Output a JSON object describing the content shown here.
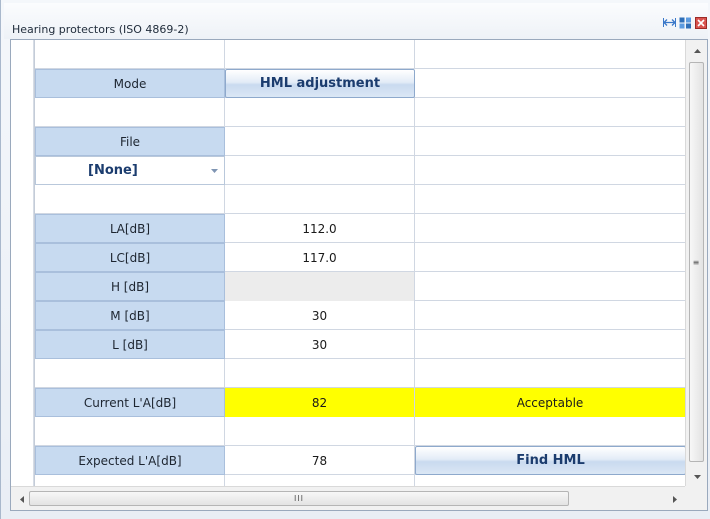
{
  "window": {
    "title": "Hearing protectors (ISO 4869-2)",
    "icons": [
      "fit-width-icon",
      "tile-icon",
      "close-icon"
    ]
  },
  "rows": {
    "mode": {
      "label": "Mode",
      "button": "HML adjustment"
    },
    "file": {
      "label": "File",
      "selected": "[None]"
    },
    "la": {
      "label_main": "L",
      "label_sub": "A",
      "label_unit": " [dB]",
      "value": "112.0"
    },
    "lc": {
      "label_main": "L",
      "label_sub": "C",
      "label_unit": " [dB]",
      "value": "117.0"
    },
    "h": {
      "label": "H [dB]",
      "value": ""
    },
    "m": {
      "label": "M [dB]",
      "value": "30"
    },
    "l": {
      "label": "L [dB]",
      "value": "30"
    },
    "current": {
      "label_main": "Current L'",
      "label_sub": "A",
      "label_unit": " [dB]",
      "value": "82",
      "status": "Acceptable"
    },
    "expected": {
      "label_main": "Expected L'",
      "label_sub": "A",
      "label_unit": " [dB]",
      "value": "78",
      "button": "Find HML"
    }
  },
  "scrollbars": {
    "horizontal_grip": "III",
    "vertical_grip": "≡"
  },
  "colors": {
    "label_bg": "#c7daf0",
    "highlight": "#ffff00",
    "button_text": "#1b3c6e"
  }
}
